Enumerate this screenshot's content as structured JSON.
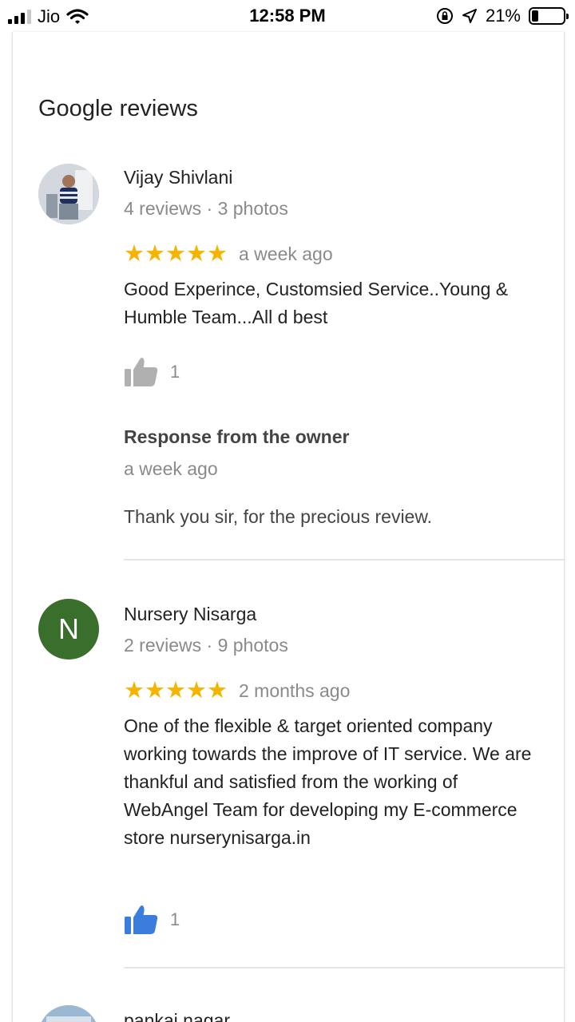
{
  "status_bar": {
    "carrier": "Jio",
    "time": "12:58 PM",
    "battery": "21%",
    "battery_level": 0.21
  },
  "section_title": "Google reviews",
  "reviews": [
    {
      "name": "Vijay Shivlani",
      "meta": "4 reviews · 3 photos",
      "rating": 5,
      "stars": "★★★★★",
      "time": "a week ago",
      "text": "Good Experince, Customsied Service..Young & Humble Team...All d best",
      "likes": "1",
      "liked": false,
      "owner_response": {
        "title": "Response from the owner",
        "time": "a week ago",
        "text": "Thank you sir, for the precious review."
      }
    },
    {
      "name": "Nursery Nisarga",
      "avatar_letter": "N",
      "meta": "2 reviews · 9 photos",
      "rating": 5,
      "stars": "★★★★★",
      "time": "2 months ago",
      "text": "One of the flexible & target oriented company working towards the improve of IT service. We are thankful and satisfied from the working of WebAngel Team  for developing my E-commerce store nurserynisarga.in",
      "likes": "1",
      "liked": true
    },
    {
      "name": "pankaj nagar"
    }
  ],
  "colors": {
    "star": "#f5b400",
    "like_active": "#3b7ddd",
    "like_inactive": "#b0b0b0",
    "avatar_letter_bg": "#3a6e2d"
  }
}
